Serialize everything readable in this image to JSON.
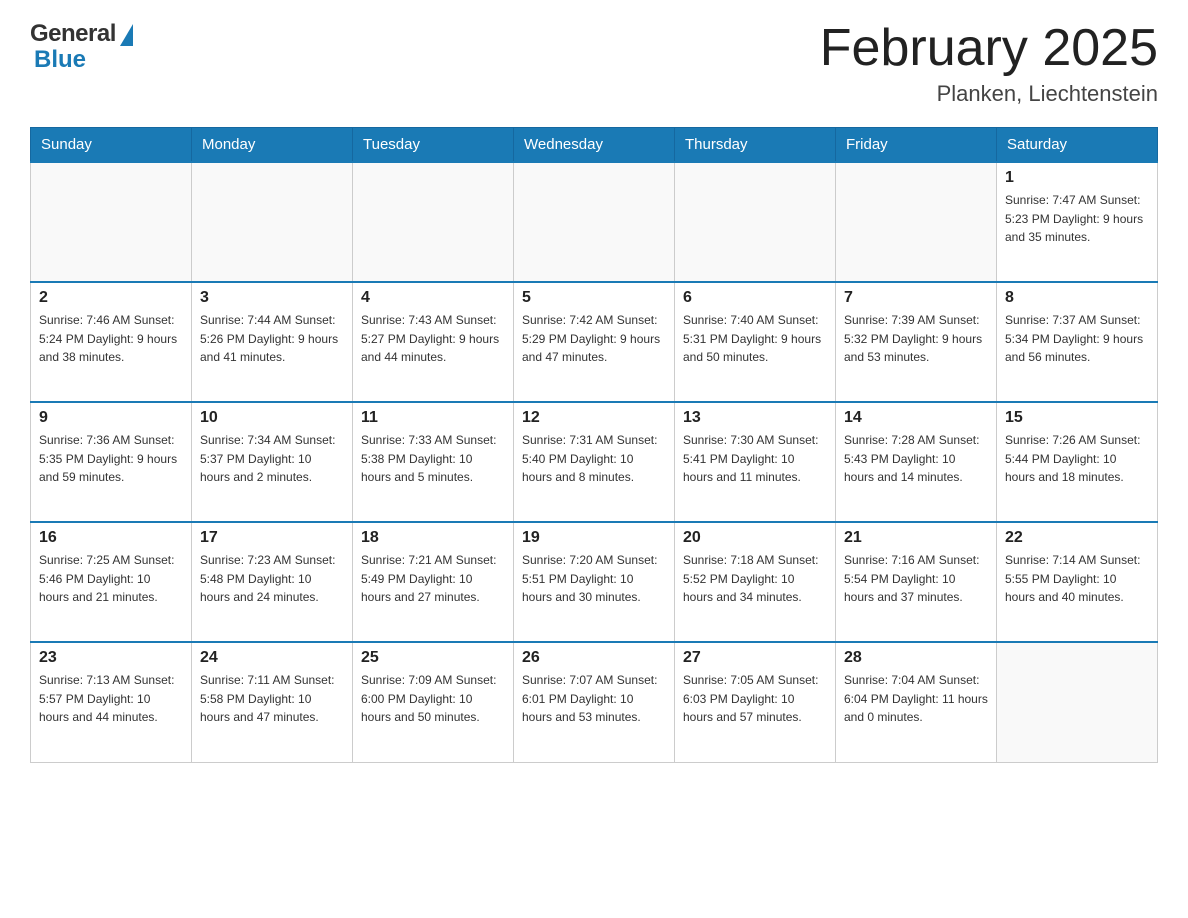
{
  "header": {
    "logo": {
      "general": "General",
      "blue": "Blue"
    },
    "month_title": "February 2025",
    "location": "Planken, Liechtenstein"
  },
  "days_of_week": [
    "Sunday",
    "Monday",
    "Tuesday",
    "Wednesday",
    "Thursday",
    "Friday",
    "Saturday"
  ],
  "weeks": [
    {
      "days": [
        {
          "num": "",
          "info": ""
        },
        {
          "num": "",
          "info": ""
        },
        {
          "num": "",
          "info": ""
        },
        {
          "num": "",
          "info": ""
        },
        {
          "num": "",
          "info": ""
        },
        {
          "num": "",
          "info": ""
        },
        {
          "num": "1",
          "info": "Sunrise: 7:47 AM\nSunset: 5:23 PM\nDaylight: 9 hours\nand 35 minutes."
        }
      ]
    },
    {
      "days": [
        {
          "num": "2",
          "info": "Sunrise: 7:46 AM\nSunset: 5:24 PM\nDaylight: 9 hours\nand 38 minutes."
        },
        {
          "num": "3",
          "info": "Sunrise: 7:44 AM\nSunset: 5:26 PM\nDaylight: 9 hours\nand 41 minutes."
        },
        {
          "num": "4",
          "info": "Sunrise: 7:43 AM\nSunset: 5:27 PM\nDaylight: 9 hours\nand 44 minutes."
        },
        {
          "num": "5",
          "info": "Sunrise: 7:42 AM\nSunset: 5:29 PM\nDaylight: 9 hours\nand 47 minutes."
        },
        {
          "num": "6",
          "info": "Sunrise: 7:40 AM\nSunset: 5:31 PM\nDaylight: 9 hours\nand 50 minutes."
        },
        {
          "num": "7",
          "info": "Sunrise: 7:39 AM\nSunset: 5:32 PM\nDaylight: 9 hours\nand 53 minutes."
        },
        {
          "num": "8",
          "info": "Sunrise: 7:37 AM\nSunset: 5:34 PM\nDaylight: 9 hours\nand 56 minutes."
        }
      ]
    },
    {
      "days": [
        {
          "num": "9",
          "info": "Sunrise: 7:36 AM\nSunset: 5:35 PM\nDaylight: 9 hours\nand 59 minutes."
        },
        {
          "num": "10",
          "info": "Sunrise: 7:34 AM\nSunset: 5:37 PM\nDaylight: 10 hours\nand 2 minutes."
        },
        {
          "num": "11",
          "info": "Sunrise: 7:33 AM\nSunset: 5:38 PM\nDaylight: 10 hours\nand 5 minutes."
        },
        {
          "num": "12",
          "info": "Sunrise: 7:31 AM\nSunset: 5:40 PM\nDaylight: 10 hours\nand 8 minutes."
        },
        {
          "num": "13",
          "info": "Sunrise: 7:30 AM\nSunset: 5:41 PM\nDaylight: 10 hours\nand 11 minutes."
        },
        {
          "num": "14",
          "info": "Sunrise: 7:28 AM\nSunset: 5:43 PM\nDaylight: 10 hours\nand 14 minutes."
        },
        {
          "num": "15",
          "info": "Sunrise: 7:26 AM\nSunset: 5:44 PM\nDaylight: 10 hours\nand 18 minutes."
        }
      ]
    },
    {
      "days": [
        {
          "num": "16",
          "info": "Sunrise: 7:25 AM\nSunset: 5:46 PM\nDaylight: 10 hours\nand 21 minutes."
        },
        {
          "num": "17",
          "info": "Sunrise: 7:23 AM\nSunset: 5:48 PM\nDaylight: 10 hours\nand 24 minutes."
        },
        {
          "num": "18",
          "info": "Sunrise: 7:21 AM\nSunset: 5:49 PM\nDaylight: 10 hours\nand 27 minutes."
        },
        {
          "num": "19",
          "info": "Sunrise: 7:20 AM\nSunset: 5:51 PM\nDaylight: 10 hours\nand 30 minutes."
        },
        {
          "num": "20",
          "info": "Sunrise: 7:18 AM\nSunset: 5:52 PM\nDaylight: 10 hours\nand 34 minutes."
        },
        {
          "num": "21",
          "info": "Sunrise: 7:16 AM\nSunset: 5:54 PM\nDaylight: 10 hours\nand 37 minutes."
        },
        {
          "num": "22",
          "info": "Sunrise: 7:14 AM\nSunset: 5:55 PM\nDaylight: 10 hours\nand 40 minutes."
        }
      ]
    },
    {
      "days": [
        {
          "num": "23",
          "info": "Sunrise: 7:13 AM\nSunset: 5:57 PM\nDaylight: 10 hours\nand 44 minutes."
        },
        {
          "num": "24",
          "info": "Sunrise: 7:11 AM\nSunset: 5:58 PM\nDaylight: 10 hours\nand 47 minutes."
        },
        {
          "num": "25",
          "info": "Sunrise: 7:09 AM\nSunset: 6:00 PM\nDaylight: 10 hours\nand 50 minutes."
        },
        {
          "num": "26",
          "info": "Sunrise: 7:07 AM\nSunset: 6:01 PM\nDaylight: 10 hours\nand 53 minutes."
        },
        {
          "num": "27",
          "info": "Sunrise: 7:05 AM\nSunset: 6:03 PM\nDaylight: 10 hours\nand 57 minutes."
        },
        {
          "num": "28",
          "info": "Sunrise: 7:04 AM\nSunset: 6:04 PM\nDaylight: 11 hours\nand 0 minutes."
        },
        {
          "num": "",
          "info": ""
        }
      ]
    }
  ]
}
